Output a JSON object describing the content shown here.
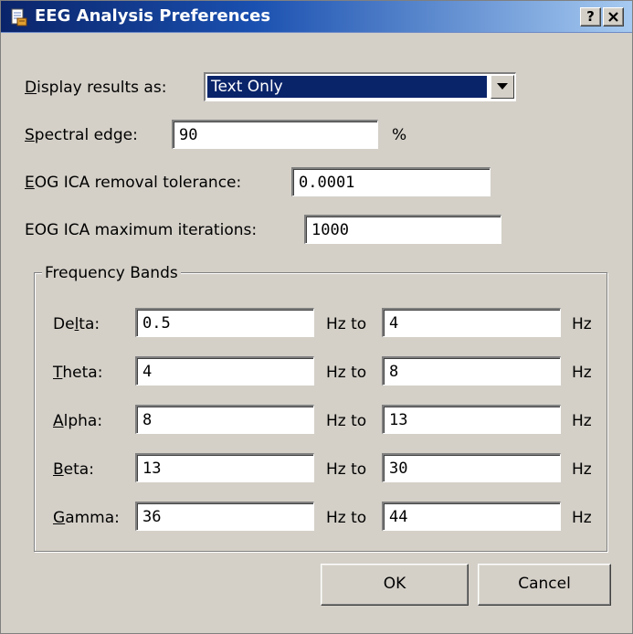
{
  "window": {
    "title": "EEG Analysis Preferences",
    "help_button": "?",
    "close_button": "✕"
  },
  "display": {
    "label_mnemonic": "D",
    "label_rest": "isplay results as:",
    "value": "Text Only"
  },
  "spectral": {
    "label_mnemonic": "S",
    "label_rest": "pectral edge:",
    "value": "90",
    "unit": "%"
  },
  "eog_tolerance": {
    "label_mnemonic": "E",
    "label_rest": "OG ICA removal tolerance:",
    "value": "0.0001"
  },
  "eog_iterations": {
    "label": "EOG ICA maximum iterations:",
    "value": "1000"
  },
  "bands": {
    "title": "Frequency Bands",
    "hz_to": "Hz to",
    "hz": "Hz",
    "rows": [
      {
        "pre": "De",
        "mnemonic": "l",
        "post": "ta:",
        "low": "0.5",
        "high": "4"
      },
      {
        "pre": "",
        "mnemonic": "T",
        "post": "heta:",
        "low": "4",
        "high": "8"
      },
      {
        "pre": "",
        "mnemonic": "A",
        "post": "lpha:",
        "low": "8",
        "high": "13"
      },
      {
        "pre": "",
        "mnemonic": "B",
        "post": "eta:",
        "low": "13",
        "high": "30"
      },
      {
        "pre": "",
        "mnemonic": "G",
        "post": "amma:",
        "low": "36",
        "high": "44"
      }
    ]
  },
  "buttons": {
    "ok": "OK",
    "cancel": "Cancel"
  },
  "colors": {
    "dialog_bg": "#d4d0c8",
    "titlebar_start": "#0a246a",
    "titlebar_end": "#a6caf0",
    "selection": "#0a246a"
  }
}
